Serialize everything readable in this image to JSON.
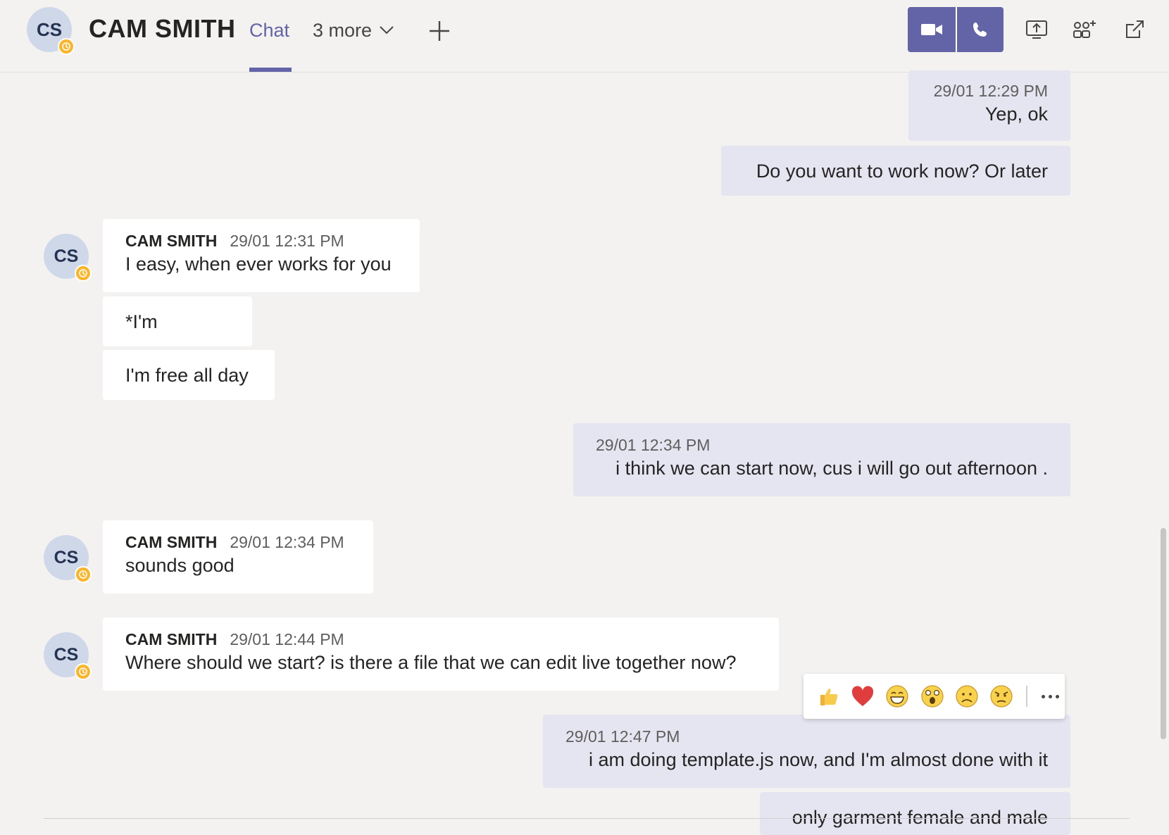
{
  "header": {
    "avatar_initials": "CS",
    "title": "CAM SMITH",
    "tabs": [
      {
        "label": "Chat",
        "active": true
      },
      {
        "label": "3 more"
      }
    ],
    "icons": [
      "add-tab-icon",
      "video-call-icon",
      "audio-call-icon",
      "share-screen-icon",
      "add-people-icon",
      "pop-out-icon"
    ]
  },
  "messages": [
    {
      "from": "me",
      "time": "29/01 12:29 PM",
      "text": "Yep, ok"
    },
    {
      "from": "me",
      "text": "Do you want to work now? Or later"
    },
    {
      "from": "them",
      "sender": "CAM SMITH",
      "initials": "CS",
      "time": "29/01 12:31 PM",
      "text": "I easy, when ever works for you"
    },
    {
      "from": "them",
      "text": "*I'm"
    },
    {
      "from": "them",
      "text": "I'm free all day"
    },
    {
      "from": "me",
      "time": "29/01 12:34 PM",
      "text": "i think we can start now, cus i will go out afternoon ."
    },
    {
      "from": "them",
      "sender": "CAM SMITH",
      "initials": "CS",
      "time": "29/01 12:34 PM",
      "text": "sounds good"
    },
    {
      "from": "them",
      "sender": "CAM SMITH",
      "initials": "CS",
      "time": "29/01 12:44 PM",
      "text": "Where should we start? is there a file that we can edit live together now?"
    },
    {
      "from": "me",
      "time": "29/01 12:47 PM",
      "text": "i am doing template.js now, and I'm almost done with it"
    },
    {
      "from": "me",
      "text": "only garment female and male"
    }
  ],
  "reactions": [
    "like",
    "heart",
    "laugh",
    "surprised",
    "sad",
    "angry"
  ],
  "colors": {
    "accent": "#6264a7",
    "mine_bubble": "#e5e5f1",
    "their_bubble": "#ffffff",
    "background": "#f3f2f1",
    "status_away": "#fcb52a"
  }
}
